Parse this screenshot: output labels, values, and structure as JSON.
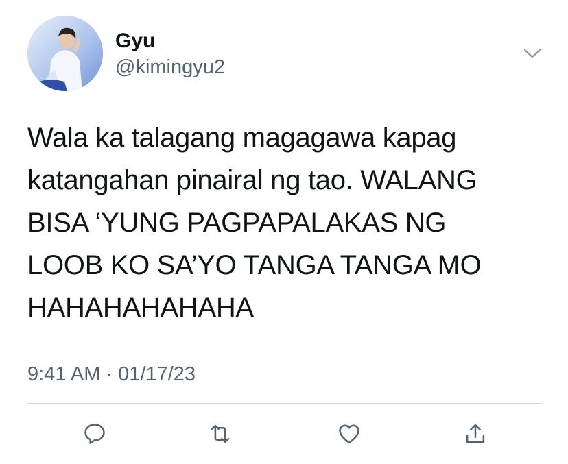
{
  "user": {
    "display_name": "Gyu",
    "handle": "@kimingyu2"
  },
  "tweet": {
    "text": "Wala ka talagang magagawa kapag\nkatangahan pinairal ng tao. WALANG\nBISA ‘YUNG PAGPAPALAKAS NG\nLOOB KO SA’YO TANGA TANGA MO\nHAHAHAHAHAHA",
    "timestamp": "9:41 AM · 01/17/23"
  },
  "icons": {
    "more": "chevron-down-icon",
    "reply": "comment-icon",
    "retweet": "retweet-icon",
    "like": "heart-icon",
    "share": "share-icon"
  },
  "colors": {
    "text": "#0f1419",
    "secondary": "#536471",
    "divider": "#cfd9de"
  }
}
